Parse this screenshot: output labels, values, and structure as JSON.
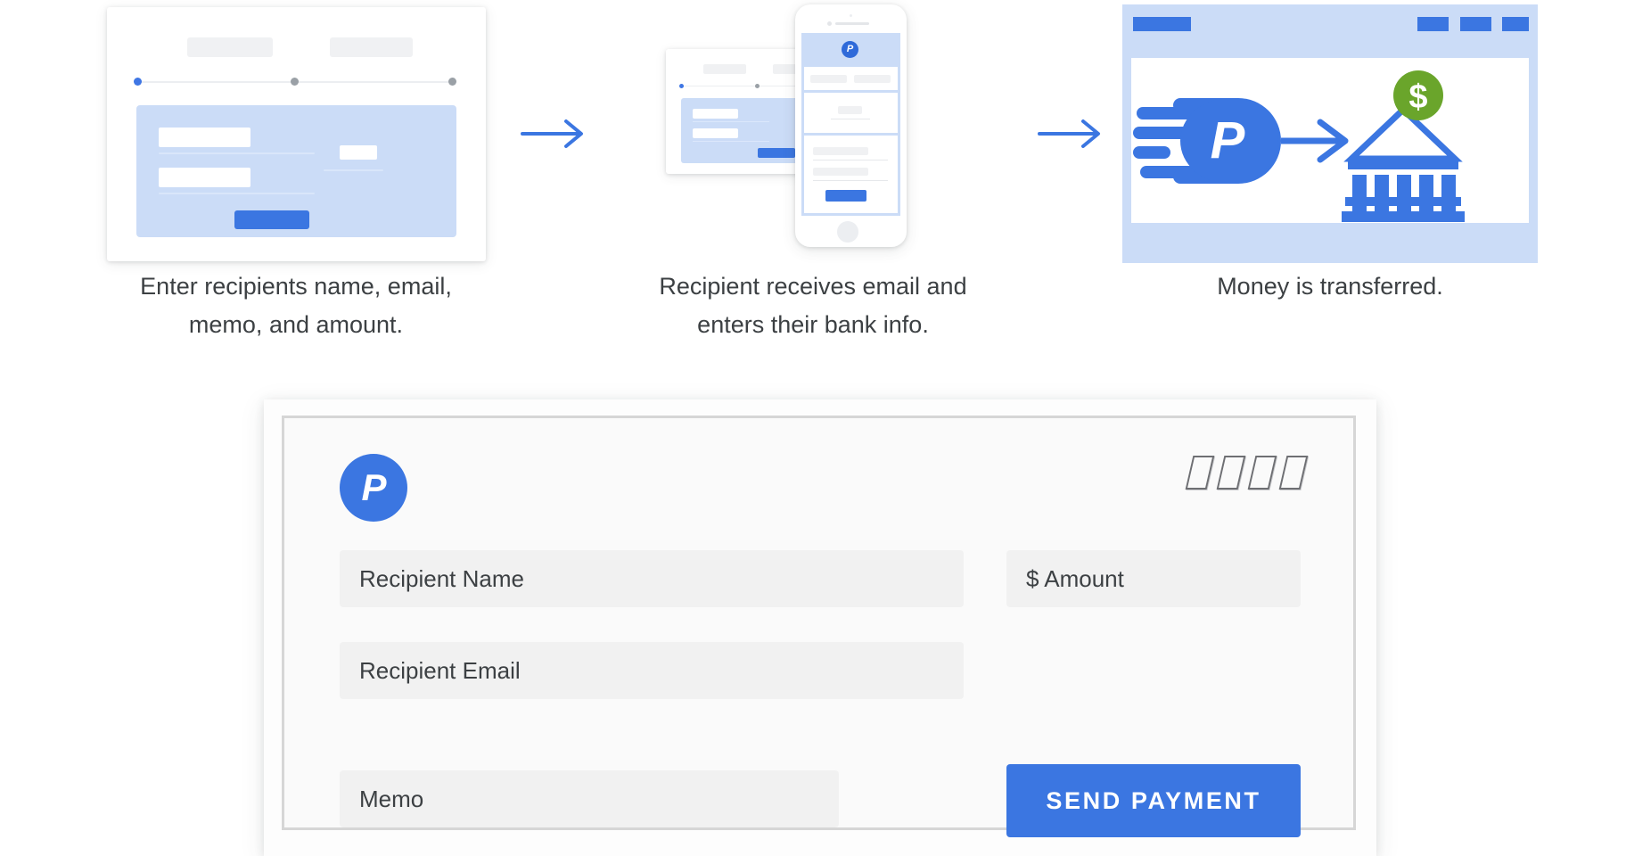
{
  "steps": [
    {
      "id": "step-enter-details",
      "caption": "Enter recipients name, email, memo, and amount.",
      "art": "desktop-form-illustration"
    },
    {
      "id": "step-recipient-email",
      "caption": "Recipient receives email and enters their bank info.",
      "art": "phone-and-card-illustration"
    },
    {
      "id": "step-money-transferred",
      "caption": "Money is transferred.",
      "art": "bank-transfer-illustration"
    }
  ],
  "arrows": {
    "glyph": "arrow-right",
    "count": 2,
    "color": "#3b76e1"
  },
  "form": {
    "logo_letter": "P",
    "decoration": {
      "name": "speed-bars",
      "count": 4
    },
    "fields": [
      {
        "name": "recipient-name",
        "placeholder": "Recipient Name",
        "value": ""
      },
      {
        "name": "amount",
        "placeholder": "$ Amount",
        "value": ""
      },
      {
        "name": "recipient-email",
        "placeholder": "Recipient Email",
        "value": ""
      },
      {
        "name": "memo",
        "placeholder": "Memo",
        "value": ""
      }
    ],
    "submit_label": "SEND PAYMENT"
  },
  "colors": {
    "brand_blue": "#3b76e1",
    "light_blue": "#cbdcf7",
    "field_grey": "#f1f1f1",
    "text_dark": "#3c4043",
    "money_green": "#6aa52b"
  }
}
